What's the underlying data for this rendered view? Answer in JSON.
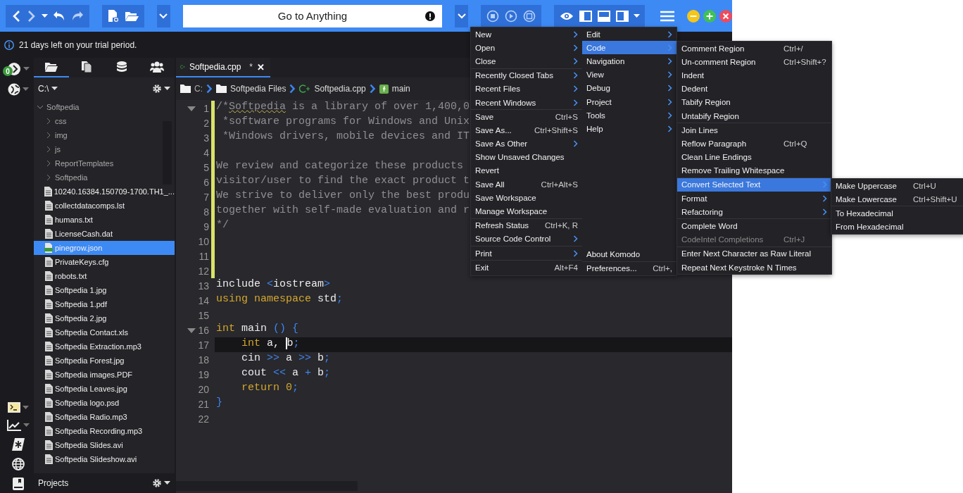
{
  "toolbar": {
    "search": {
      "placeholder": "Go to Anything"
    }
  },
  "info_bar": {
    "message": "21 days left on your trial period."
  },
  "left_strip": {
    "badge": "0"
  },
  "sidebar": {
    "tabs": [
      {
        "kind": "places",
        "selected": true
      },
      {
        "kind": "files",
        "selected": false
      },
      {
        "kind": "database",
        "selected": false
      },
      {
        "kind": "people",
        "selected": false
      }
    ],
    "path": "C:\\",
    "tree": [
      {
        "name": "Softpedia",
        "kind": "folder",
        "expanded": true,
        "selected": false,
        "children": [
          {
            "name": "css",
            "kind": "folder",
            "expanded": false,
            "selected": false
          },
          {
            "name": "img",
            "kind": "folder",
            "expanded": false,
            "selected": false
          },
          {
            "name": "js",
            "kind": "folder",
            "expanded": false,
            "selected": false
          },
          {
            "name": "ReportTemplates",
            "kind": "folder",
            "expanded": false,
            "selected": false
          },
          {
            "name": "Softpedia",
            "kind": "folder",
            "expanded": false,
            "selected": false
          },
          {
            "name": "10240.16384.150709-1700.TH1_...",
            "kind": "file",
            "selected": false
          },
          {
            "name": "collectdatacomps.lst",
            "kind": "file",
            "selected": false
          },
          {
            "name": "humans.txt",
            "kind": "file",
            "selected": false
          },
          {
            "name": "LicenseCash.dat",
            "kind": "file",
            "selected": false
          },
          {
            "name": "pinegrow.json",
            "kind": "json",
            "selected": true
          },
          {
            "name": "PrivateKeys.cfg",
            "kind": "file",
            "selected": false
          },
          {
            "name": "robots.txt",
            "kind": "file",
            "selected": false
          },
          {
            "name": "Softpedia 1.jpg",
            "kind": "file",
            "selected": false
          },
          {
            "name": "Softpedia 1.pdf",
            "kind": "file",
            "selected": false
          },
          {
            "name": "Softpedia 2.jpg",
            "kind": "file",
            "selected": false
          },
          {
            "name": "Softpedia Contact.xls",
            "kind": "file",
            "selected": false
          },
          {
            "name": "Softpedia Extraction.mp3",
            "kind": "file",
            "selected": false
          },
          {
            "name": "Softpedia Forest.jpg",
            "kind": "file",
            "selected": false
          },
          {
            "name": "Softpedia images.PDF",
            "kind": "file",
            "selected": false
          },
          {
            "name": "Softpedia Leaves.jpg",
            "kind": "file",
            "selected": false
          },
          {
            "name": "Softpedia logo.psd",
            "kind": "file",
            "selected": false
          },
          {
            "name": "Softpedia Radio.mp3",
            "kind": "file",
            "selected": false
          },
          {
            "name": "Softpedia Recording.mp3",
            "kind": "file",
            "selected": false
          },
          {
            "name": "Softpedia Slides.avi",
            "kind": "file",
            "selected": false
          },
          {
            "name": "Softpedia Slideshow.avi",
            "kind": "file",
            "selected": false
          }
        ]
      }
    ],
    "footer": "Projects"
  },
  "editor": {
    "tab": {
      "title": "Softpedia.cpp",
      "modified_mark": "*",
      "close": "✕"
    },
    "breadcrumb": [
      {
        "kind": "drive",
        "label": "C:"
      },
      {
        "kind": "folder",
        "label": "Softpedia Files"
      },
      {
        "kind": "cpp",
        "label": "Softpedia.cpp"
      },
      {
        "kind": "function",
        "label": "main"
      }
    ],
    "lines": [
      {
        "number": "1",
        "fold": true,
        "changed": true,
        "current": false,
        "tokens": [
          {
            "kind": "comment",
            "text": "/*"
          },
          {
            "kind": "misspelled",
            "text": "Softpedia"
          },
          {
            "kind": "comment",
            "text": " is a library of over 1,400,0"
          }
        ]
      },
      {
        "number": "2",
        "fold": false,
        "changed": true,
        "current": false,
        "tokens": [
          {
            "kind": "comment",
            "text": " *software programs for Windows and Unix"
          }
        ]
      },
      {
        "number": "3",
        "fold": false,
        "changed": true,
        "current": false,
        "tokens": [
          {
            "kind": "comment",
            "text": " *Windows drivers, mobile devices and IT"
          }
        ]
      },
      {
        "number": "4",
        "fold": false,
        "changed": true,
        "current": false
      },
      {
        "number": "5",
        "fold": false,
        "changed": true,
        "current": false,
        "tokens": [
          {
            "kind": "comment",
            "text": "We review and categorize these products"
          }
        ]
      },
      {
        "number": "6",
        "fold": false,
        "changed": true,
        "current": false,
        "tokens": [
          {
            "kind": "comment",
            "text": "visitor/user to find the exact product t"
          }
        ]
      },
      {
        "number": "7",
        "fold": false,
        "changed": true,
        "current": false,
        "tokens": [
          {
            "kind": "comment",
            "text": "We strive to deliver only the best produ"
          }
        ]
      },
      {
        "number": "8",
        "fold": false,
        "changed": true,
        "current": false,
        "tokens": [
          {
            "kind": "comment",
            "text": "together with self-made evaluation and r"
          }
        ]
      },
      {
        "number": "9",
        "fold": false,
        "changed": true,
        "current": false,
        "tokens": [
          {
            "kind": "comment",
            "text": "*/"
          }
        ]
      },
      {
        "number": "10",
        "fold": false,
        "changed": true,
        "current": false
      },
      {
        "number": "11",
        "fold": false,
        "changed": true,
        "current": false
      },
      {
        "number": "12",
        "fold": false,
        "changed": true,
        "current": false
      },
      {
        "number": "13",
        "fold": false,
        "changed": false,
        "current": false,
        "tokens": [
          {
            "kind": "plain",
            "text": "include "
          },
          {
            "kind": "op",
            "text": "<"
          },
          {
            "kind": "plain",
            "text": "iostream"
          },
          {
            "kind": "op",
            "text": ">"
          }
        ]
      },
      {
        "number": "14",
        "fold": false,
        "changed": false,
        "current": false,
        "tokens": [
          {
            "kind": "keyword",
            "text": "using namespace "
          },
          {
            "kind": "plain",
            "text": "std"
          },
          {
            "kind": "op",
            "text": ";"
          }
        ]
      },
      {
        "number": "15",
        "fold": false,
        "changed": false,
        "current": false
      },
      {
        "number": "16",
        "fold": true,
        "changed": false,
        "current": false,
        "tokens": [
          {
            "kind": "keyword",
            "text": "int "
          },
          {
            "kind": "plain",
            "text": "main "
          },
          {
            "kind": "op",
            "text": "() {"
          }
        ]
      },
      {
        "number": "17",
        "fold": false,
        "changed": false,
        "current": true,
        "tokens": [
          {
            "kind": "keyword",
            "text": "    int "
          },
          {
            "kind": "plain",
            "text": "a, "
          },
          {
            "kind": "caret"
          },
          {
            "kind": "plain",
            "text": "b"
          },
          {
            "kind": "op",
            "text": ";"
          }
        ]
      },
      {
        "number": "18",
        "fold": false,
        "changed": false,
        "current": false,
        "tokens": [
          {
            "kind": "plain",
            "text": "    cin "
          },
          {
            "kind": "op",
            "text": ">>"
          },
          {
            "kind": "plain",
            "text": " a "
          },
          {
            "kind": "op",
            "text": ">>"
          },
          {
            "kind": "plain",
            "text": " b"
          },
          {
            "kind": "op",
            "text": ";"
          }
        ]
      },
      {
        "number": "19",
        "fold": false,
        "changed": false,
        "current": false,
        "tokens": [
          {
            "kind": "plain",
            "text": "    cout "
          },
          {
            "kind": "op",
            "text": "<<"
          },
          {
            "kind": "plain",
            "text": " a "
          },
          {
            "kind": "op",
            "text": "+"
          },
          {
            "kind": "plain",
            "text": " b"
          },
          {
            "kind": "op",
            "text": ";"
          }
        ]
      },
      {
        "number": "20",
        "fold": false,
        "changed": false,
        "current": false,
        "tokens": [
          {
            "kind": "keyword",
            "text": "    return "
          },
          {
            "kind": "number",
            "text": "0"
          },
          {
            "kind": "op",
            "text": ";"
          }
        ]
      },
      {
        "number": "21",
        "fold": false,
        "changed": false,
        "current": false,
        "tokens": [
          {
            "kind": "op",
            "text": "}"
          }
        ]
      },
      {
        "number": "22",
        "fold": false,
        "changed": false,
        "current": false
      }
    ]
  },
  "app_menu": {
    "columns": [
      {
        "sections": [
          [
            {
              "label": "New",
              "submenu": true,
              "selected": false,
              "disabled": false
            },
            {
              "label": "Open",
              "submenu": true,
              "selected": false,
              "disabled": false
            },
            {
              "label": "Close",
              "submenu": true,
              "selected": false,
              "disabled": false
            }
          ],
          [
            {
              "label": "Recently Closed Tabs",
              "submenu": true,
              "selected": false,
              "disabled": false
            },
            {
              "label": "Recent Files",
              "submenu": true,
              "selected": false,
              "disabled": false
            },
            {
              "label": "Recent Windows",
              "submenu": true,
              "selected": false,
              "disabled": false
            }
          ],
          [
            {
              "label": "Save",
              "shortcut": "Ctrl+S",
              "submenu": false,
              "selected": false,
              "disabled": false
            },
            {
              "label": "Save As...",
              "shortcut": "Ctrl+Shift+S",
              "submenu": false,
              "selected": false,
              "disabled": false
            },
            {
              "label": "Save As Other",
              "submenu": true,
              "selected": false,
              "disabled": false
            },
            {
              "label": "Show Unsaved Changes",
              "submenu": false,
              "selected": false,
              "disabled": false
            },
            {
              "label": "Revert",
              "submenu": false,
              "selected": false,
              "disabled": false
            },
            {
              "label": "Save All",
              "shortcut": "Ctrl+Alt+S",
              "submenu": false,
              "selected": false,
              "disabled": false
            },
            {
              "label": "Save Workspace",
              "submenu": false,
              "selected": false,
              "disabled": false
            },
            {
              "label": "Manage Workspace",
              "submenu": false,
              "selected": false,
              "disabled": false
            }
          ],
          [
            {
              "label": "Refresh Status",
              "shortcut": "Ctrl+K, R",
              "submenu": false,
              "selected": false,
              "disabled": false
            },
            {
              "label": "Source Code Control",
              "submenu": true,
              "selected": false,
              "disabled": false
            }
          ],
          [
            {
              "label": "Print",
              "submenu": true,
              "selected": false,
              "disabled": false
            }
          ],
          [
            {
              "label": "Exit",
              "shortcut": "Alt+F4",
              "submenu": false,
              "selected": false,
              "disabled": false
            }
          ]
        ]
      },
      {
        "sections": [
          [
            {
              "label": "Edit",
              "submenu": true,
              "selected": false,
              "disabled": false
            },
            {
              "label": "Code",
              "submenu": true,
              "selected": true,
              "disabled": false
            },
            {
              "label": "Navigation",
              "submenu": true,
              "selected": false,
              "disabled": false
            },
            {
              "label": "View",
              "submenu": true,
              "selected": false,
              "disabled": false
            },
            {
              "label": "Debug",
              "submenu": true,
              "selected": false,
              "disabled": false
            },
            {
              "label": "Project",
              "submenu": true,
              "selected": false,
              "disabled": false
            },
            {
              "label": "Tools",
              "submenu": true,
              "selected": false,
              "disabled": false
            },
            {
              "label": "Help",
              "submenu": true,
              "selected": false,
              "disabled": false
            }
          ]
        ],
        "bottom_sections": [
          [
            {
              "label": "About Komodo",
              "submenu": false,
              "selected": false,
              "disabled": false
            }
          ],
          [
            {
              "label": "Preferences...",
              "shortcut": "Ctrl+,",
              "submenu": false,
              "selected": false,
              "disabled": false
            }
          ]
        ]
      }
    ]
  },
  "code_menu": {
    "sections": [
      [
        {
          "label": "Comment Region",
          "shortcut": "Ctrl+/",
          "submenu": false,
          "selected": false,
          "disabled": false
        },
        {
          "label": "Un-comment Region",
          "shortcut": "Ctrl+Shift+?",
          "submenu": false,
          "selected": false,
          "disabled": false
        },
        {
          "label": "Indent",
          "submenu": false,
          "selected": false,
          "disabled": false
        },
        {
          "label": "Dedent",
          "submenu": false,
          "selected": false,
          "disabled": false
        },
        {
          "label": "Tabify Region",
          "submenu": false,
          "selected": false,
          "disabled": false
        },
        {
          "label": "Untabify Region",
          "submenu": false,
          "selected": false,
          "disabled": false
        }
      ],
      [
        {
          "label": "Join Lines",
          "submenu": false,
          "selected": false,
          "disabled": false
        },
        {
          "label": "Reflow Paragraph",
          "shortcut": "Ctrl+Q",
          "submenu": false,
          "selected": false,
          "disabled": false
        },
        {
          "label": "Clean Line Endings",
          "submenu": false,
          "selected": false,
          "disabled": false
        },
        {
          "label": "Remove Trailing Whitespace",
          "submenu": false,
          "selected": false,
          "disabled": false
        }
      ],
      [
        {
          "label": "Convert Selected Text",
          "submenu": true,
          "selected": true,
          "disabled": false
        },
        {
          "label": "Format",
          "submenu": true,
          "selected": false,
          "disabled": false
        },
        {
          "label": "Refactoring",
          "submenu": true,
          "selected": false,
          "disabled": false
        }
      ],
      [
        {
          "label": "Complete Word",
          "submenu": false,
          "selected": false,
          "disabled": false
        },
        {
          "label": "CodeIntel Completions",
          "shortcut": "Ctrl+J",
          "submenu": false,
          "selected": false,
          "disabled": true
        }
      ],
      [
        {
          "label": "Enter Next Character as Raw Literal",
          "submenu": false,
          "selected": false,
          "disabled": false
        },
        {
          "label": "Repeat Next Keystroke N Times",
          "submenu": false,
          "selected": false,
          "disabled": false
        }
      ]
    ]
  },
  "convert_menu": {
    "sections": [
      [
        {
          "label": "Make Uppercase",
          "shortcut": "Ctrl+U",
          "submenu": false,
          "selected": false,
          "disabled": false
        },
        {
          "label": "Make Lowercase",
          "shortcut": "Ctrl+Shift+U",
          "submenu": false,
          "selected": false,
          "disabled": false
        }
      ],
      [
        {
          "label": "To Hexadecimal",
          "submenu": false,
          "selected": false,
          "disabled": false
        },
        {
          "label": "From Hexadecimal",
          "submenu": false,
          "selected": false,
          "disabled": false
        }
      ]
    ]
  }
}
